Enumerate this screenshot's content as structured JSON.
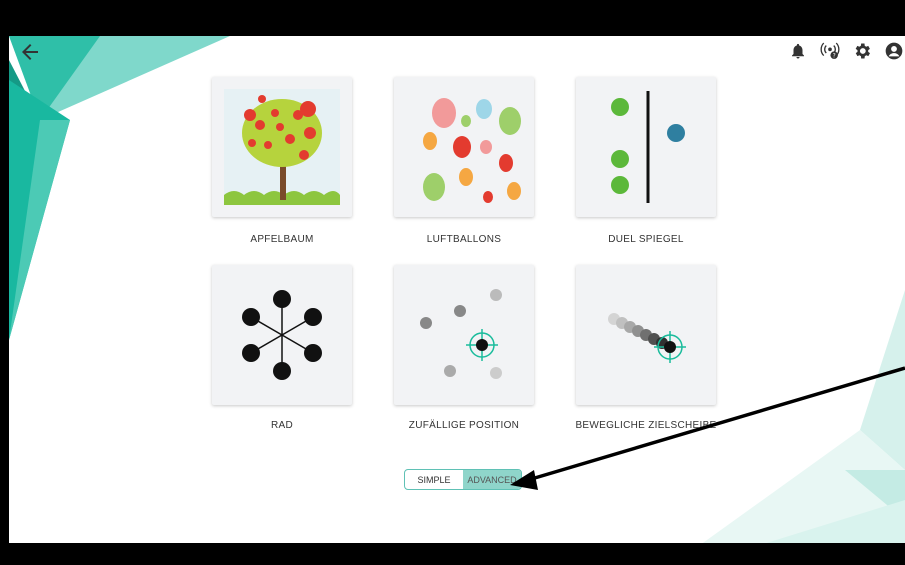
{
  "colors": {
    "accent": "#1abc9c",
    "toggle_active": "#8fd5ca",
    "card_bg": "#f2f3f5"
  },
  "header": {
    "back_icon": "arrow-left-icon",
    "icons": [
      "bell-icon",
      "broadcast-help-icon",
      "gear-icon",
      "account-icon"
    ]
  },
  "exercises": [
    {
      "label": "APFELBAUM",
      "icon": "apple-tree"
    },
    {
      "label": "LUFTBALLONS",
      "icon": "balloons"
    },
    {
      "label": "DUEL SPIEGEL",
      "icon": "mirror-dots"
    },
    {
      "label": "RAD",
      "icon": "wheel"
    },
    {
      "label": "ZUFÄLLIGE POSITION",
      "icon": "random-target"
    },
    {
      "label": "BEWEGLICHE ZIELSCHEIBE",
      "icon": "moving-target"
    }
  ],
  "mode_toggle": {
    "simple_label": "SIMPLE",
    "advanced_label": "ADVANCED",
    "selected": "ADVANCED"
  }
}
